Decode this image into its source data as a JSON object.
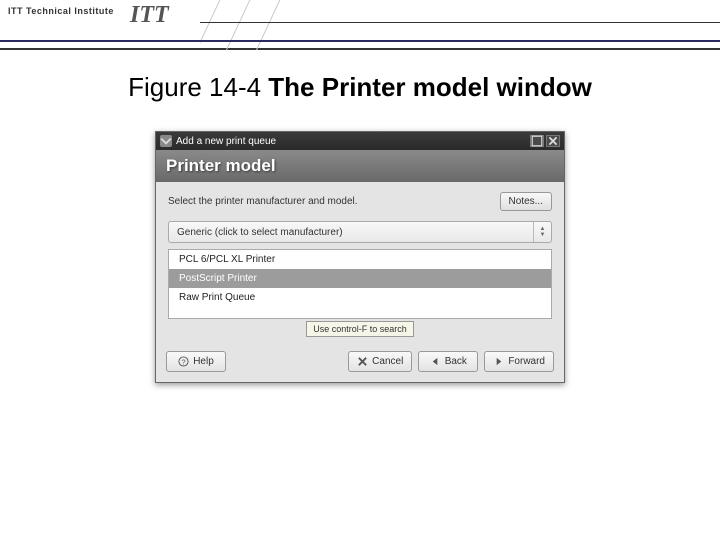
{
  "banner": {
    "institute": "ITT Technical Institute",
    "logo": "ITT"
  },
  "caption": {
    "prefix": "Figure 14-4 ",
    "title": "The Printer model window"
  },
  "dialog": {
    "window_title": "Add a new print queue",
    "header": "Printer model",
    "instruction": "Select the printer manufacturer and model.",
    "notes_button": "Notes...",
    "manufacturer_combo": "Generic (click to select manufacturer)",
    "models": [
      {
        "label": "PCL 6/PCL XL Printer",
        "selected": false
      },
      {
        "label": "PostScript Printer",
        "selected": true
      },
      {
        "label": "Raw Print Queue",
        "selected": false
      }
    ],
    "search_tip": "Use control-F to search",
    "buttons": {
      "help": "Help",
      "cancel": "Cancel",
      "back": "Back",
      "forward": "Forward"
    }
  }
}
